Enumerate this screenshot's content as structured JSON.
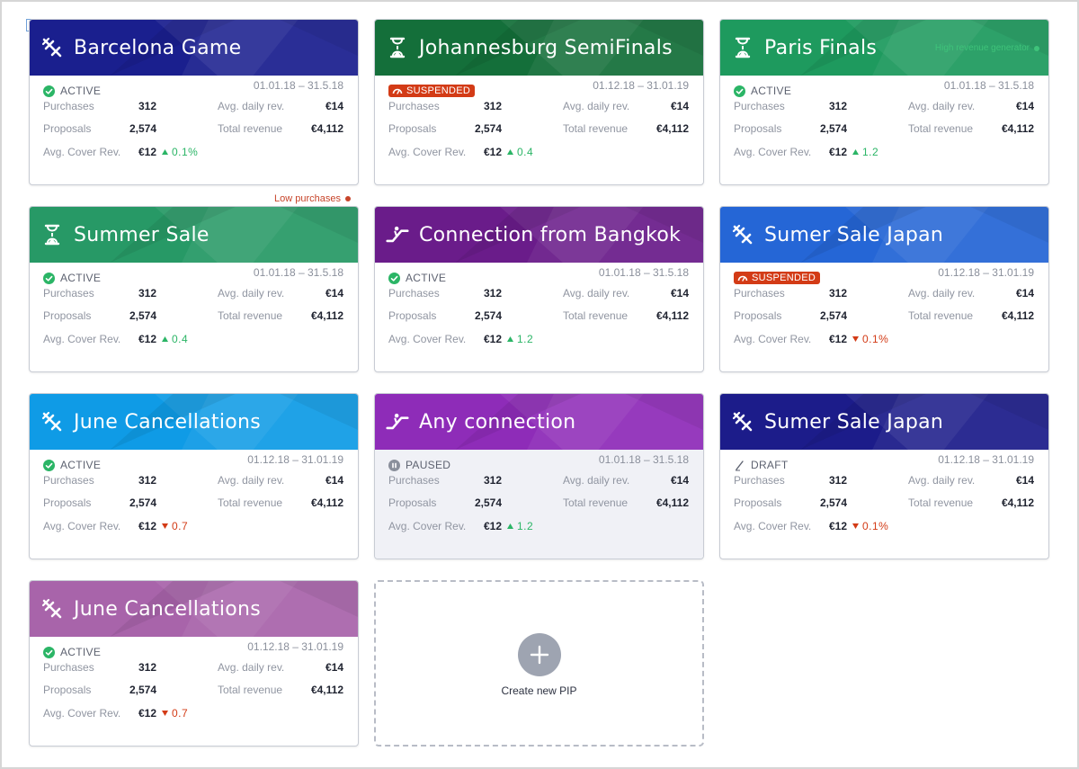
{
  "colors": {
    "navy": "#1a1f8e",
    "green_dark": "#146f3a",
    "green": "#1e9a5e",
    "teal_green": "#279966",
    "purple_dark": "#6a1c8a",
    "blue": "#2566d6",
    "sky": "#0f9be6",
    "violet": "#8e2cb8",
    "indigo": "#1c1c8a",
    "mauve": "#a864aa",
    "up": "#2bb566",
    "down": "#d33b16"
  },
  "labels": {
    "purchases": "Purchases",
    "proposals": "Proposals",
    "avg_cover": "Avg. Cover Rev.",
    "avg_daily": "Avg. daily rev.",
    "total_revenue": "Total revenue"
  },
  "cards": [
    {
      "title": "Barcelona Game",
      "icon": "plane-icon",
      "color": "#1a1f8e",
      "status": "ACTIVE",
      "status_kind": "active",
      "dates": "01.01.18 – 31.5.18",
      "purchases": "312",
      "proposals": "2,574",
      "avg_cover": "€12",
      "avg_daily": "€14",
      "total_revenue": "€4,112",
      "trend": "0.1%",
      "trend_dir": "up"
    },
    {
      "title": "Johannesburg SemiFinals",
      "icon": "hourglass-icon",
      "color": "#146f3a",
      "status": "SUSPENDED",
      "status_kind": "suspended",
      "dates": "01.12.18 – 31.01.19",
      "purchases": "312",
      "proposals": "2,574",
      "avg_cover": "€12",
      "avg_daily": "€14",
      "total_revenue": "€4,112",
      "trend": "0.4",
      "trend_dir": "up"
    },
    {
      "title": "Paris Finals",
      "icon": "hourglass-icon",
      "color": "#1e9a5e",
      "status": "ACTIVE",
      "status_kind": "active",
      "dates": "01.01.18 – 31.5.18",
      "purchases": "312",
      "proposals": "2,574",
      "avg_cover": "€12",
      "avg_daily": "€14",
      "total_revenue": "€4,112",
      "trend": "1.2",
      "trend_dir": "up",
      "header_note": "High revenue generator",
      "header_note_color": "#3fc37a"
    },
    {
      "title": "Summer Sale",
      "icon": "hourglass-icon",
      "color": "#279966",
      "status": "ACTIVE",
      "status_kind": "active",
      "dates": "01.01.18 – 31.5.18",
      "purchases": "312",
      "proposals": "2,574",
      "avg_cover": "€12",
      "avg_daily": "€14",
      "total_revenue": "€4,112",
      "trend": "0.4",
      "trend_dir": "up",
      "above_note": "Low purchases",
      "above_note_color": "#c7442a"
    },
    {
      "title": "Connection from Bangkok",
      "icon": "escalator-icon",
      "color": "#6a1c8a",
      "status": "ACTIVE",
      "status_kind": "active",
      "dates": "01.01.18 – 31.5.18",
      "purchases": "312",
      "proposals": "2,574",
      "avg_cover": "€12",
      "avg_daily": "€14",
      "total_revenue": "€4,112",
      "trend": "1.2",
      "trend_dir": "up"
    },
    {
      "title": "Sumer Sale Japan",
      "icon": "plane-icon",
      "color": "#2566d6",
      "status": "SUSPENDED",
      "status_kind": "suspended",
      "dates": "01.12.18 – 31.01.19",
      "purchases": "312",
      "proposals": "2,574",
      "avg_cover": "€12",
      "avg_daily": "€14",
      "total_revenue": "€4,112",
      "trend": "0.1%",
      "trend_dir": "down"
    },
    {
      "title": "June Cancellations",
      "icon": "plane-icon",
      "color": "#0f9be6",
      "status": "ACTIVE",
      "status_kind": "active",
      "dates": "01.12.18 – 31.01.19",
      "purchases": "312",
      "proposals": "2,574",
      "avg_cover": "€12",
      "avg_daily": "€14",
      "total_revenue": "€4,112",
      "trend": "0.7",
      "trend_dir": "down"
    },
    {
      "title": "Any connection",
      "icon": "escalator-icon",
      "color": "#8e2cb8",
      "status": "PAUSED",
      "status_kind": "paused",
      "dates": "01.01.18 – 31.5.18",
      "purchases": "312",
      "proposals": "2,574",
      "avg_cover": "€12",
      "avg_daily": "€14",
      "total_revenue": "€4,112",
      "trend": "1.2",
      "trend_dir": "up"
    },
    {
      "title": "Sumer Sale Japan",
      "icon": "plane-icon",
      "color": "#1c1c8a",
      "status": "DRAFT",
      "status_kind": "draft",
      "dates": "01.12.18 – 31.01.19",
      "purchases": "312",
      "proposals": "2,574",
      "avg_cover": "€12",
      "avg_daily": "€14",
      "total_revenue": "€4,112",
      "trend": "0.1%",
      "trend_dir": "down"
    },
    {
      "title": "June Cancellations",
      "icon": "plane-icon",
      "color": "#a864aa",
      "status": "ACTIVE",
      "status_kind": "active",
      "dates": "01.12.18 – 31.01.19",
      "purchases": "312",
      "proposals": "2,574",
      "avg_cover": "€12",
      "avg_daily": "€14",
      "total_revenue": "€4,112",
      "trend": "0.7",
      "trend_dir": "down"
    }
  ],
  "create": {
    "label": "Create new PIP",
    "icon": "plus-icon"
  }
}
